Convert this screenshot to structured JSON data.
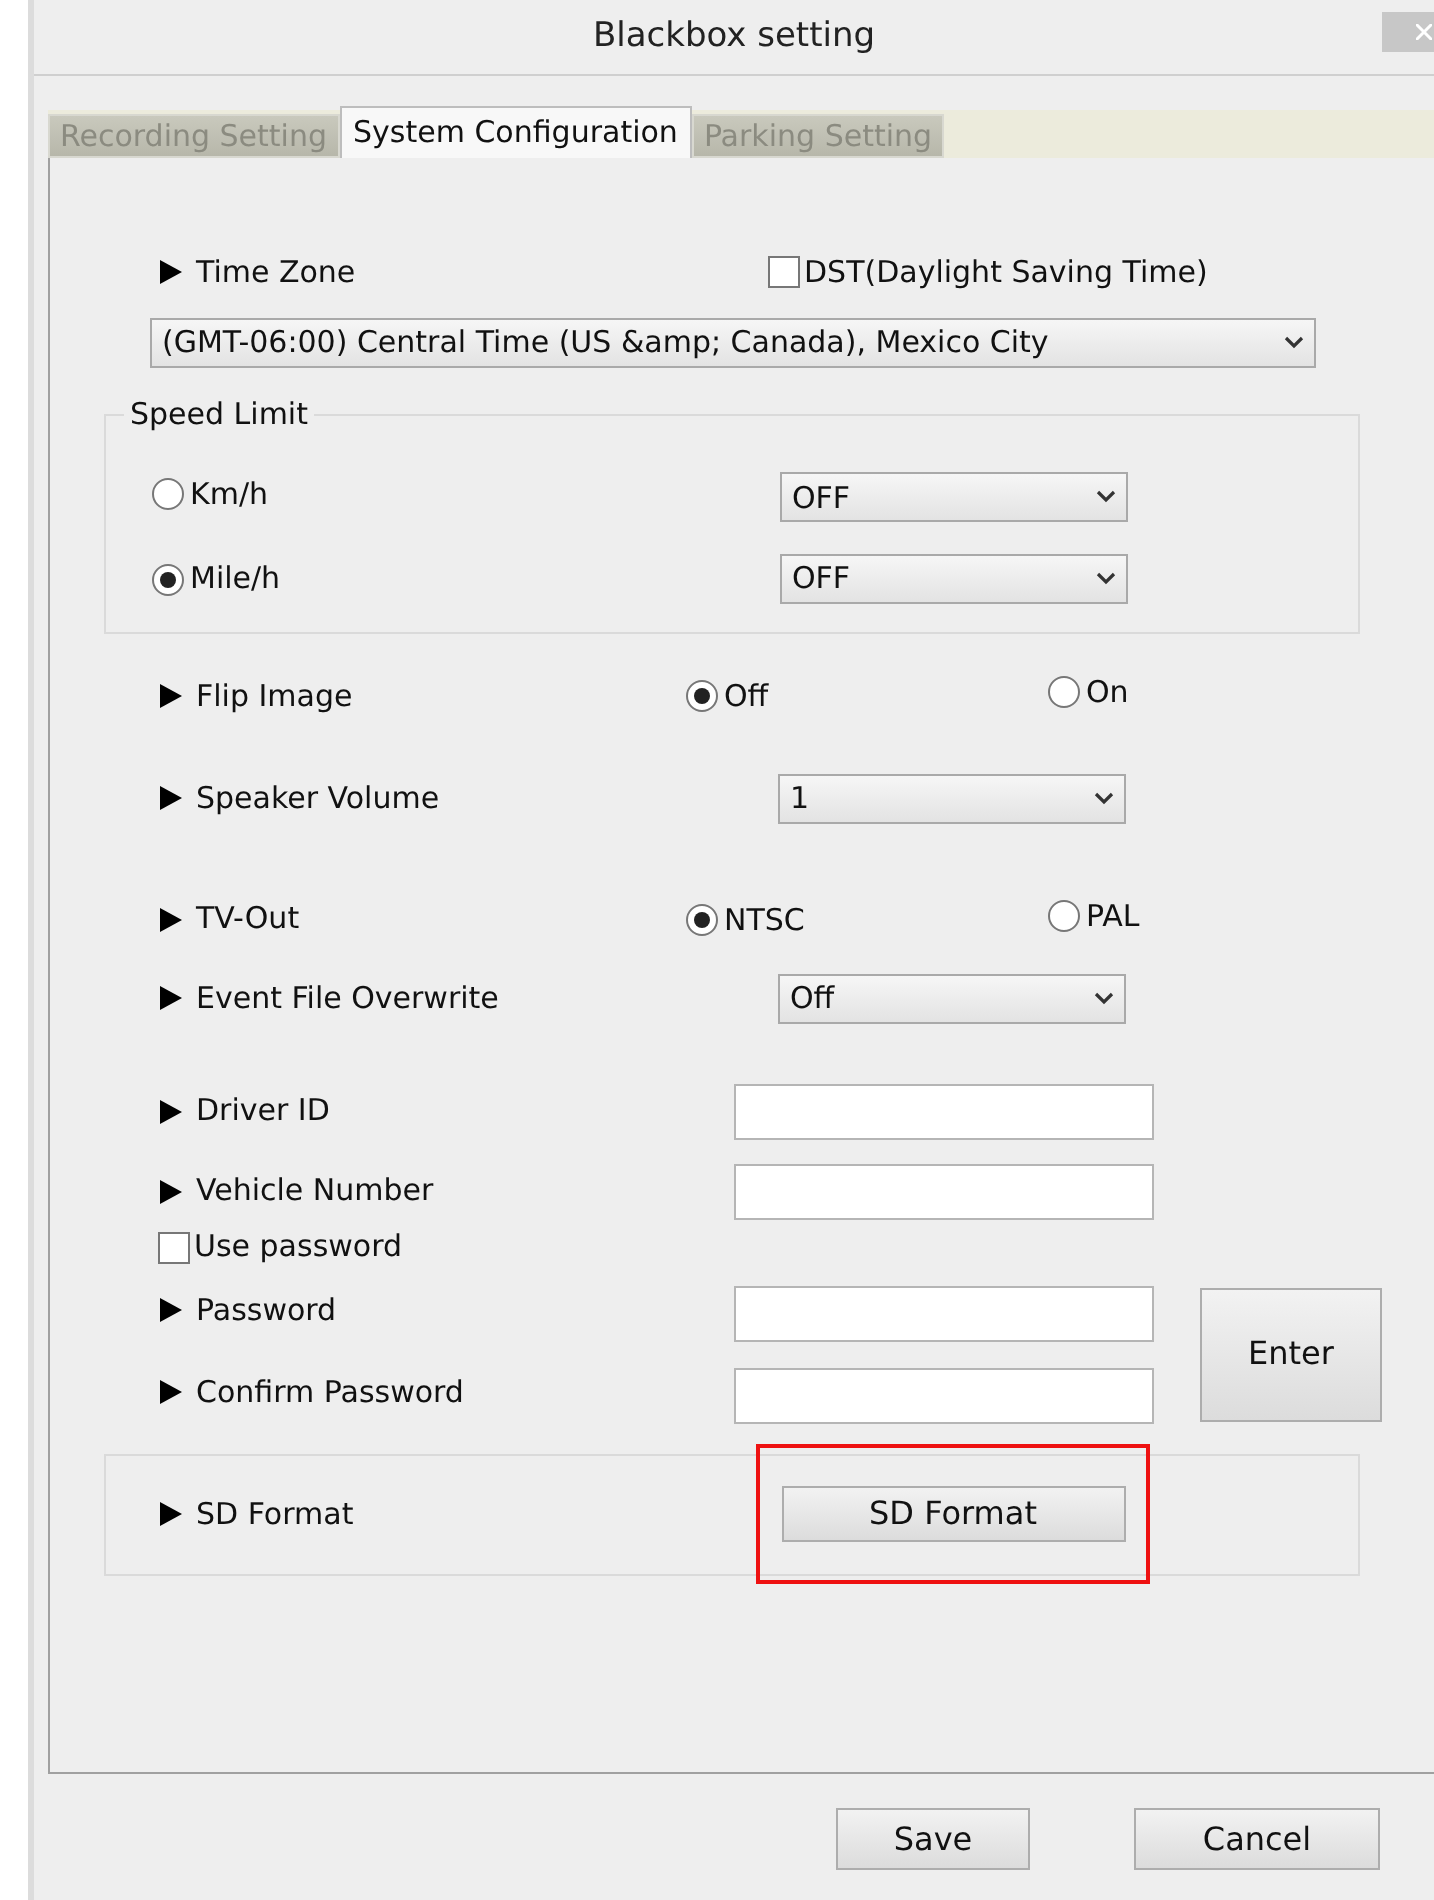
{
  "window": {
    "title": "Blackbox setting"
  },
  "tabs": [
    {
      "label": "Recording Setting",
      "selected": false
    },
    {
      "label": "System Configuration",
      "selected": true
    },
    {
      "label": "Parking Setting",
      "selected": false
    }
  ],
  "time_zone": {
    "label": "Time Zone",
    "dst": {
      "label": "DST(Daylight Saving Time)",
      "checked": false
    },
    "value": "(GMT-06:00) Central Time (US &amp; Canada), Mexico City"
  },
  "speed_limit": {
    "title": "Speed Limit",
    "units": [
      {
        "label": "Km/h",
        "selected": false,
        "value": "OFF"
      },
      {
        "label": "Mile/h",
        "selected": true,
        "value": "OFF"
      }
    ]
  },
  "settings": [
    {
      "kind": "radio",
      "label": "Flip Image",
      "options": [
        {
          "label": "Off",
          "selected": true
        },
        {
          "label": "On",
          "selected": false
        }
      ]
    },
    {
      "kind": "select",
      "label": "Speaker Volume",
      "value": "1"
    },
    {
      "kind": "radio",
      "label": "TV-Out",
      "options": [
        {
          "label": "NTSC",
          "selected": true
        },
        {
          "label": "PAL",
          "selected": false
        }
      ]
    },
    {
      "kind": "select",
      "label": "Event File Overwrite",
      "value": "Off"
    },
    {
      "kind": "input",
      "label": "Driver ID"
    },
    {
      "kind": "input",
      "label": "Vehicle Number"
    }
  ],
  "password": {
    "use": {
      "label": "Use password",
      "checked": false
    },
    "fields": [
      {
        "label": "Password"
      },
      {
        "label": "Confirm Password"
      }
    ],
    "enter_button": "Enter"
  },
  "sd_format": {
    "label": "SD Format",
    "button": "SD Format",
    "highlighted": true
  },
  "buttons": [
    "Save",
    "Cancel"
  ]
}
